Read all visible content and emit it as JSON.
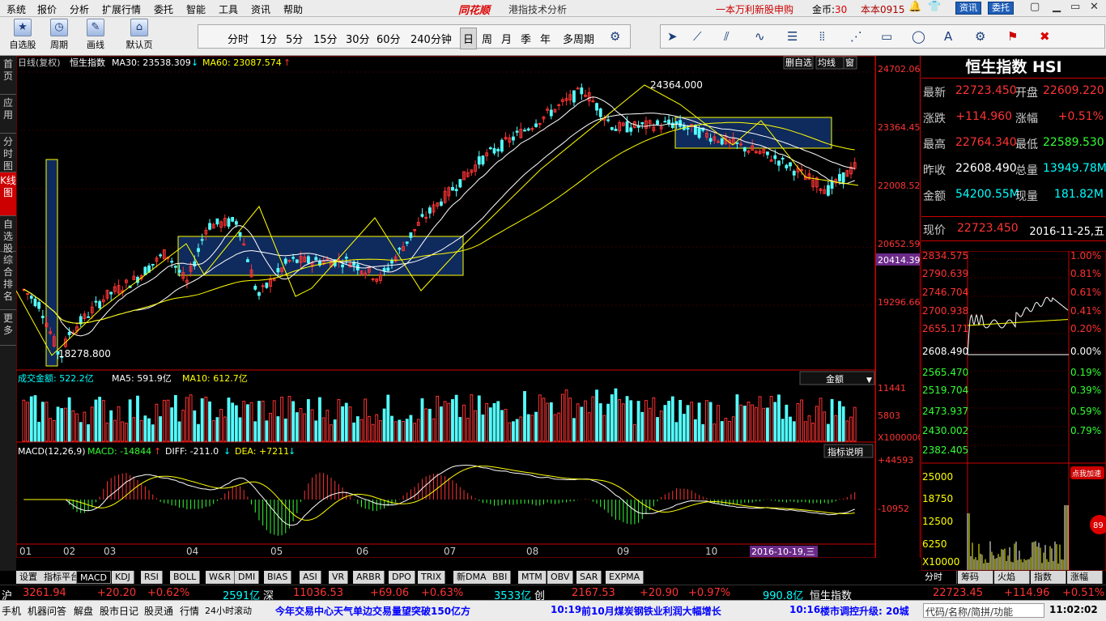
{
  "menu": [
    "系统",
    "报价",
    "分析",
    "扩展行情",
    "委托",
    "智能",
    "工具",
    "资讯",
    "帮助"
  ],
  "logo": "同花顺",
  "app_title": "港指技术分析",
  "promo": "一本万利新股申购",
  "gold_label": "金币:",
  "gold_value": "30",
  "user": "本本0915",
  "window_buttons": [
    "资讯",
    "委托"
  ],
  "toolbar_big": [
    {
      "label": "自选股",
      "icon": "★"
    },
    {
      "label": "周期",
      "icon": "◷"
    },
    {
      "label": "画线",
      "icon": "✎"
    },
    {
      "label": "默认页",
      "icon": "⌂"
    }
  ],
  "periods": [
    "分时",
    "1分",
    "5分",
    "15分",
    "30分",
    "60分",
    "240分钟",
    "日",
    "周",
    "月",
    "季",
    "年",
    "多周期"
  ],
  "active_period": "日",
  "draw_tools": [
    "arrow-icon",
    "line-icon",
    "parallel-icon",
    "wave-icon",
    "fib-icon",
    "bars-icon",
    "channel-icon",
    "rect-icon",
    "circle-icon",
    "text-icon",
    "gear-icon",
    "flag-icon",
    "delete-icon"
  ],
  "left_tabs": [
    {
      "label": "首页",
      "active": false
    },
    {
      "label": "应用",
      "active": false
    },
    {
      "label": "分时图",
      "active": false
    },
    {
      "label": "K线图",
      "active": true
    },
    {
      "label": "自选股",
      "active": false
    },
    {
      "label": "综合排名",
      "active": false
    },
    {
      "label": "更多",
      "active": false
    }
  ],
  "kline": {
    "header_period": "日线(复权)",
    "name": "恒生指数",
    "ma30_label": "MA30: 23538.309",
    "ma60_label": "MA60: 23087.574",
    "buttons": [
      "删自选",
      "均线",
      "窗"
    ],
    "high_label": "24364.000",
    "low_label": "18278.800",
    "y_ticks": [
      "24702.06",
      "23364.45",
      "22008.52",
      "20652.59",
      "19296.66"
    ],
    "current_tag": "20414.39",
    "ymin": 18100,
    "ymax": 24800
  },
  "volume": {
    "label": "成交金额: 522.2亿",
    "ma5_label": "MA5: 591.9亿",
    "ma10_label": "MA10: 612.7亿",
    "selector": "金额",
    "y_ticks": [
      "11441",
      "5803",
      "X1000000"
    ]
  },
  "macd": {
    "label": "MACD(12,26,9)",
    "macd_value": "MACD: -14844",
    "diff_value": "DIFF: -211.0",
    "dea_value": "DEA: +7211",
    "explain_button": "指标说明",
    "y_ticks": [
      "+44593",
      "-10952"
    ]
  },
  "x_axis": {
    "months": [
      "01",
      "02",
      "03",
      "04",
      "05",
      "06",
      "07",
      "08",
      "09",
      "10"
    ],
    "cursor_date": "2016-10-19,三"
  },
  "quote": {
    "title": "恒生指数 HSI",
    "rows": [
      {
        "l": "最新",
        "v": "22723.450",
        "vc": "r",
        "l2": "开盘",
        "v2": "22609.220",
        "v2c": "r"
      },
      {
        "l": "涨跌",
        "v": "+114.960",
        "vc": "r",
        "l2": "涨幅",
        "v2": "+0.51%",
        "v2c": "r"
      },
      {
        "l": "最高",
        "v": "22764.340",
        "vc": "r",
        "l2": "最低",
        "v2": "22589.530",
        "v2c": "g"
      },
      {
        "l": "昨收",
        "v": "22608.490",
        "vc": "w",
        "l2": "总量",
        "v2": "13949.78M",
        "v2c": "c"
      },
      {
        "l": "金额",
        "v": "54200.55M",
        "vc": "c",
        "l2": "现量",
        "v2": "181.82M",
        "v2c": "c"
      }
    ],
    "now_label": "现价",
    "now_value": "22723.450",
    "now_date": "2016-11-25,五"
  },
  "intraday": {
    "price_ticks": [
      "2834.575",
      "2790.639",
      "2746.704",
      "2700.938",
      "2655.171",
      "2608.490",
      "2565.470",
      "2519.704",
      "2473.937",
      "2430.002",
      "2382.405"
    ],
    "pct_ticks": [
      "1.00%",
      "0.81%",
      "0.61%",
      "0.41%",
      "0.20%",
      "0.00%",
      "0.19%",
      "0.39%",
      "0.59%",
      "0.79%"
    ],
    "vol_ticks": [
      "25000",
      "18750",
      "12500",
      "6250",
      "X10000"
    ],
    "promo_badge": "点我加速",
    "badge_number": "89"
  },
  "bottom_tabs": [
    "设置",
    "指标平台",
    "MACD",
    "KDJ",
    "RSI",
    "BOLL",
    "W&R",
    "DMI",
    "BIAS",
    "ASI",
    "VR",
    "ARBR",
    "DPO",
    "TRIX",
    "新DMA",
    "BBI",
    "MTM",
    "OBV",
    "SAR",
    "EXPMA"
  ],
  "active_bottom_tab": "MACD",
  "right_tabs": [
    "分时",
    "筹码",
    "火焰",
    "指数",
    "涨幅"
  ],
  "index_bar": {
    "sh_label": "沪",
    "sh_value": "3261.94",
    "sh_change": "+20.20",
    "sh_pct": "+0.62%",
    "sh_amount": "2591亿",
    "sz_label": "深",
    "sz_value": "11036.53",
    "sz_change": "+69.06",
    "sz_pct": "+0.63%",
    "cy_amount": "3533亿",
    "cy_label": "创",
    "cy_value": "2167.53",
    "cy_change": "+20.90",
    "cy_pct": "+0.97%",
    "cy_amount2": "990.8亿",
    "hs_label": "恒生指数",
    "hs_value": "22723.45",
    "hs_change": "+114.96",
    "hs_pct": "+0.51%"
  },
  "status": {
    "items": [
      "手机",
      "机器问答",
      "解盘",
      "股市日记",
      "股灵通",
      "行情",
      "24小时滚动"
    ],
    "news1": "今年交易中心天气单边交易量望突破150亿方",
    "news2_time": "10:19",
    "news2": "前10月煤炭钢铁业利润大幅增长",
    "news3_time": "10:16",
    "news3": "楼市调控升级: 20城",
    "search": "代码/名称/简拼/功能",
    "clock": "11:02:02"
  },
  "colors": {
    "up": "#ff3333",
    "down": "#54ffff",
    "ma_white": "#ffffff",
    "ma_yellow": "#ffff00",
    "box": "#0f2a5c"
  }
}
